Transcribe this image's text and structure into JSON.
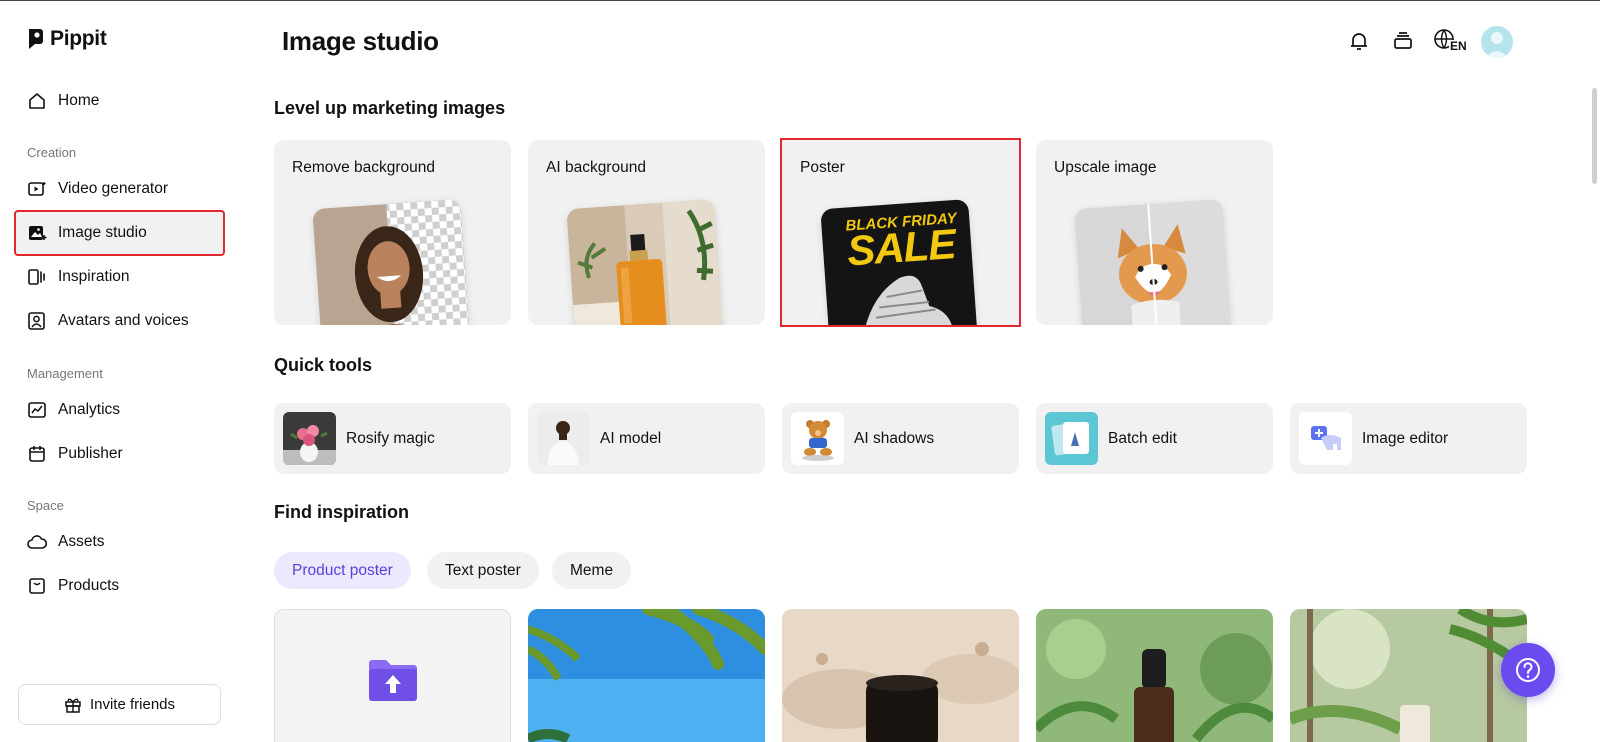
{
  "app": {
    "name": "Pippit"
  },
  "header": {
    "title": "Image studio",
    "language": "EN"
  },
  "sidebar": {
    "items": [
      {
        "label": "Home"
      },
      {
        "label": "Video generator"
      },
      {
        "label": "Image studio"
      },
      {
        "label": "Inspiration"
      },
      {
        "label": "Avatars and voices"
      },
      {
        "label": "Analytics"
      },
      {
        "label": "Publisher"
      },
      {
        "label": "Assets"
      },
      {
        "label": "Products"
      }
    ],
    "sections": {
      "creation": "Creation",
      "management": "Management",
      "space": "Space"
    },
    "invite_label": "Invite friends"
  },
  "marketing": {
    "title": "Level up marketing images",
    "cards": [
      {
        "label": "Remove background"
      },
      {
        "label": "AI background"
      },
      {
        "label": "Poster",
        "poster_line1": "BLACK FRIDAY",
        "poster_line2": "SALE"
      },
      {
        "label": "Upscale image"
      }
    ]
  },
  "quick_tools": {
    "title": "Quick tools",
    "items": [
      {
        "label": "Rosify magic"
      },
      {
        "label": "AI model"
      },
      {
        "label": "AI shadows"
      },
      {
        "label": "Batch edit"
      },
      {
        "label": "Image editor"
      }
    ]
  },
  "inspiration": {
    "title": "Find inspiration",
    "chips": [
      {
        "label": "Product poster",
        "active": true
      },
      {
        "label": "Text poster"
      },
      {
        "label": "Meme"
      }
    ]
  },
  "colors": {
    "accent": "#6a4bf0",
    "highlight": "#e0282e",
    "card_bg": "#f1f1f1"
  }
}
